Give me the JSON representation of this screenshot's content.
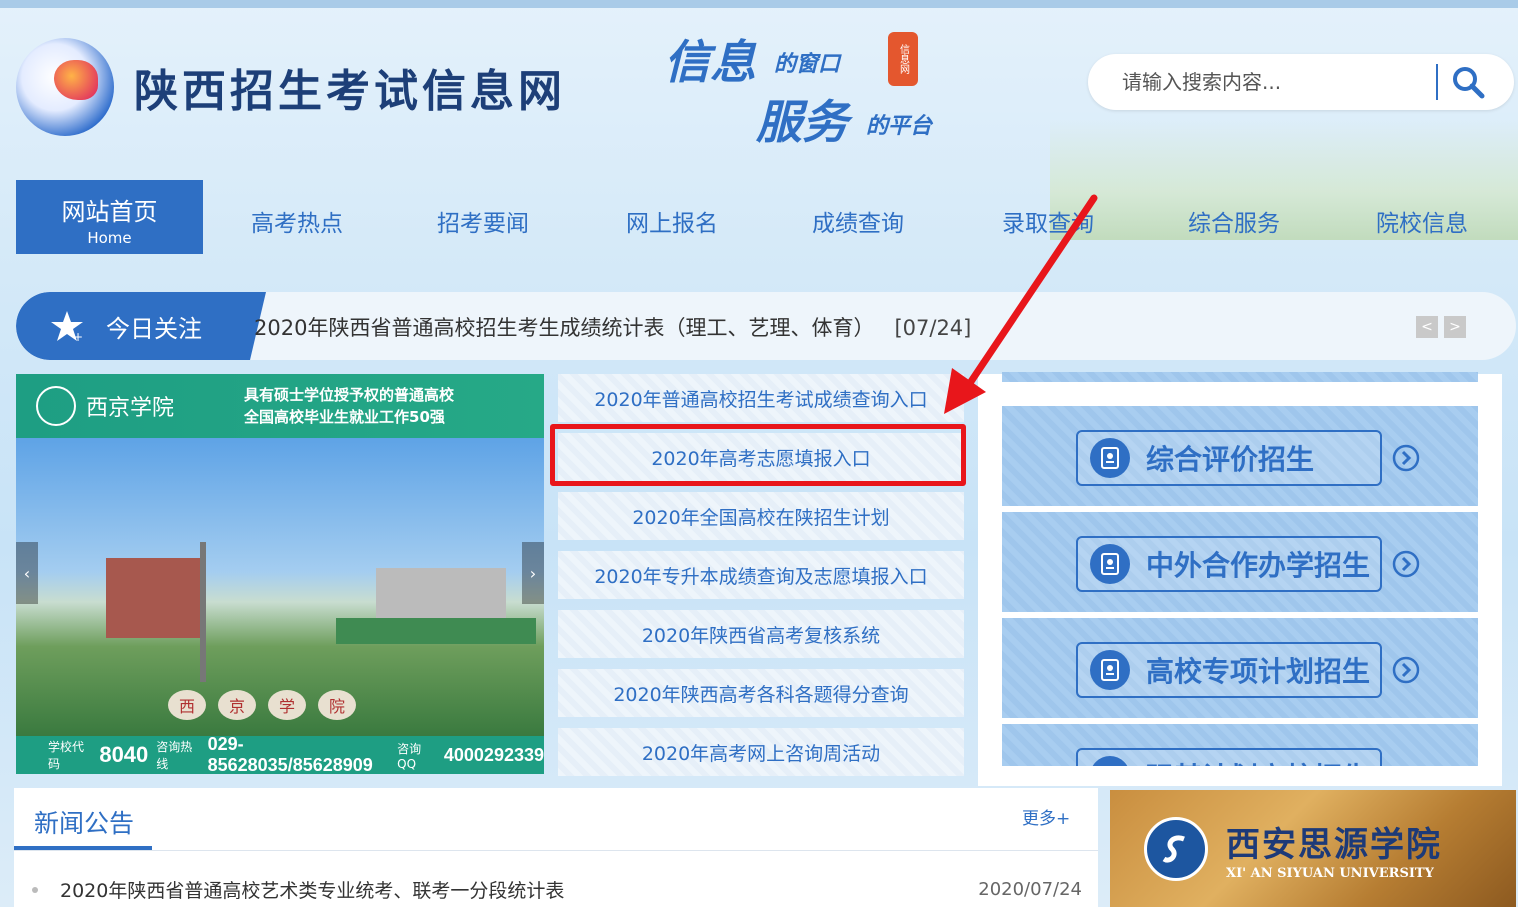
{
  "header": {
    "site_title": "陕西招生考试信息网",
    "slogan": {
      "big1": "信息",
      "small1": "的窗口",
      "big2": "服务",
      "small2": "的平台",
      "seal": "信息网"
    },
    "search": {
      "placeholder": "请输入搜索内容..."
    }
  },
  "nav": {
    "home_cn": "网站首页",
    "home_en": "Home",
    "items": [
      "高考热点",
      "招考要闻",
      "网上报名",
      "成绩查询",
      "录取查询",
      "综合服务",
      "院校信息"
    ]
  },
  "ticker": {
    "label": "今日关注",
    "text": "2020年陕西省普通高校招生考生成绩统计表（理工、艺理、体育）",
    "date": "[07/24]",
    "prev": "<",
    "next": ">"
  },
  "banner": {
    "school": "西京学院",
    "slogan_line1": "具有硕士学位授予权的普通高校",
    "slogan_line2": "全国高校毕业生就业工作50强",
    "sign_chars": [
      "西",
      "京",
      "学",
      "院"
    ],
    "code_label": "学校代码",
    "code_value": "8040",
    "hotline_label": "咨询热线",
    "hotline_value": "029-85628035/85628909",
    "qq_label": "咨询QQ",
    "qq_value": "4000292339",
    "prev": "‹",
    "next": "›"
  },
  "quick_links": [
    "2020年普通高校招生考试成绩查询入口",
    "2020年高考志愿填报入口",
    "2020年全国高校在陕招生计划",
    "2020年专升本成绩查询及志愿填报入口",
    "2020年陕西省高考复核系统",
    "2020年陕西高考各科各题得分查询",
    "2020年高考网上咨询周活动"
  ],
  "right_panel": [
    "综合评价招生",
    "中外合作办学招生",
    "高校专项计划招生",
    "强基计划高校招生"
  ],
  "news": {
    "title": "新闻公告",
    "more": "更多+",
    "items": [
      {
        "text": "2020年陕西省普通高校艺术类专业统考、联考一分段统计表",
        "date": "2020/07/24"
      }
    ]
  },
  "ad": {
    "cn": "西安思源学院",
    "en": "XI' AN SIYUAN UNIVERSITY"
  },
  "colors": {
    "brand": "#2f6fc4",
    "annotation": "#e8161b"
  }
}
